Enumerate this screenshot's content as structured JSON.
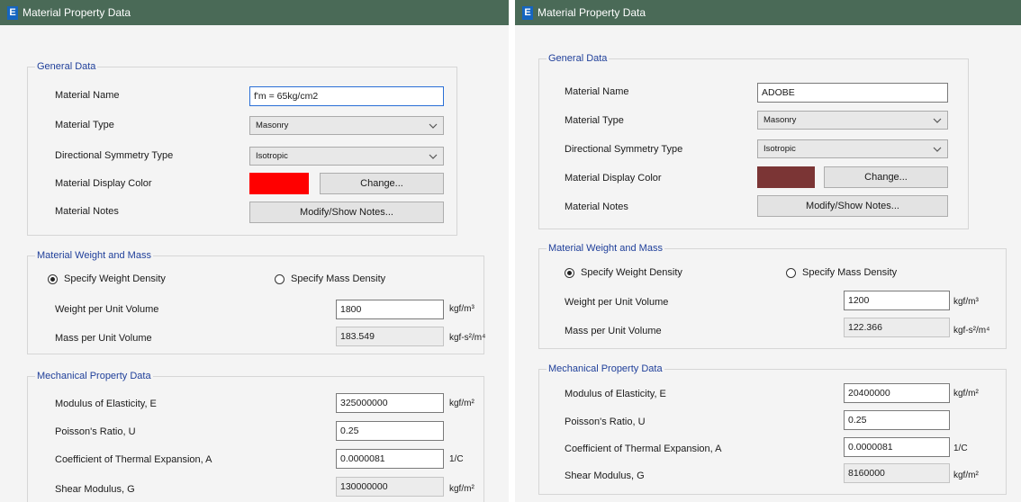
{
  "left": {
    "title": "Material Property Data",
    "general": {
      "heading": "General Data",
      "material_name_label": "Material Name",
      "material_name": "f'm = 65kg/cm2",
      "material_type_label": "Material Type",
      "material_type": "Masonry",
      "symmetry_label": "Directional Symmetry Type",
      "symmetry": "Isotropic",
      "display_color_label": "Material Display Color",
      "display_color": "#ff0000",
      "change_button": "Change...",
      "notes_label": "Material Notes",
      "notes_button": "Modify/Show Notes..."
    },
    "weight": {
      "heading": "Material Weight and Mass",
      "specify_weight": "Specify Weight Density",
      "specify_mass": "Specify Mass Density",
      "selected": "weight",
      "weight_label": "Weight per Unit Volume",
      "weight_value": "1800",
      "weight_unit": "kgf/m³",
      "mass_label": "Mass per Unit Volume",
      "mass_value": "183.549",
      "mass_unit": "kgf-s²/m⁴"
    },
    "mechanical": {
      "heading": "Mechanical Property Data",
      "e_label": "Modulus of Elasticity,  E",
      "e_value": "325000000",
      "e_unit": "kgf/m²",
      "u_label": "Poisson's Ratio,  U",
      "u_value": "0.25",
      "a_label": "Coefficient of Thermal Expansion,  A",
      "a_value": "0.0000081",
      "a_unit": "1/C",
      "g_label": "Shear Modulus,  G",
      "g_value": "130000000",
      "g_unit": "kgf/m²"
    }
  },
  "right": {
    "title": "Material Property Data",
    "general": {
      "heading": "General Data",
      "material_name_label": "Material Name",
      "material_name": "ADOBE",
      "material_type_label": "Material Type",
      "material_type": "Masonry",
      "symmetry_label": "Directional Symmetry Type",
      "symmetry": "Isotropic",
      "display_color_label": "Material Display Color",
      "display_color": "#7b3535",
      "change_button": "Change...",
      "notes_label": "Material Notes",
      "notes_button": "Modify/Show Notes..."
    },
    "weight": {
      "heading": "Material Weight and Mass",
      "specify_weight": "Specify Weight Density",
      "specify_mass": "Specify Mass Density",
      "selected": "weight",
      "weight_label": "Weight per Unit Volume",
      "weight_value": "1200",
      "weight_unit": "kgf/m³",
      "mass_label": "Mass per Unit Volume",
      "mass_value": "122.366",
      "mass_unit": "kgf-s²/m⁴"
    },
    "mechanical": {
      "heading": "Mechanical Property Data",
      "e_label": "Modulus of Elasticity,  E",
      "e_value": "20400000",
      "e_unit": "kgf/m²",
      "u_label": "Poisson's Ratio,  U",
      "u_value": "0.25",
      "a_label": "Coefficient of Thermal Expansion,  A",
      "a_value": "0.0000081",
      "a_unit": "1/C",
      "g_label": "Shear Modulus,  G",
      "g_value": "8160000",
      "g_unit": "kgf/m²"
    }
  }
}
